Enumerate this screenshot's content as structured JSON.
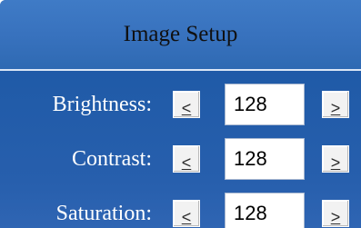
{
  "panel": {
    "title": "Image Setup"
  },
  "rows": [
    {
      "label": "Brightness:",
      "value": "128",
      "decrease_label": "<",
      "increase_label": ">"
    },
    {
      "label": "Contrast:",
      "value": "128",
      "decrease_label": "<",
      "increase_label": ">"
    },
    {
      "label": "Saturation:",
      "value": "128",
      "decrease_label": "<",
      "increase_label": ">"
    }
  ],
  "colors": {
    "header": "#3872be",
    "panel": "#1f5aa7",
    "label_text": "#ffffff"
  }
}
